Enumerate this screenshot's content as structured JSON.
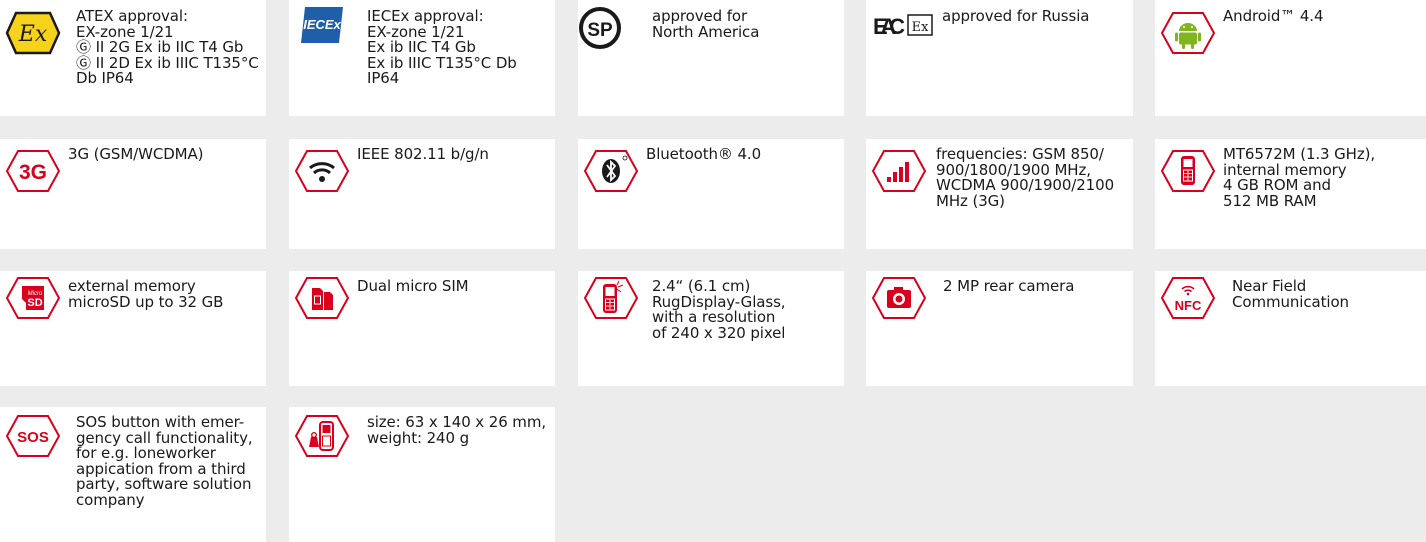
{
  "features": [
    {
      "id": "atex",
      "icon": "atex-ex-icon",
      "text": "ATEX approval:\nEX-zone 1/21\nⒼ II 2G Ex ib IIC T4 Gb\nⒼ II 2D Ex ib IIIC T135°C\nDb IP64"
    },
    {
      "id": "iecex",
      "icon": "iecex-logo",
      "text": "IECEx approval:\nEX-zone 1/21\nEx ib IIC T4 Gb\nEx ib IIIC T135°C Db\nIP64"
    },
    {
      "id": "csa",
      "icon": "csa-logo",
      "text": "approved for\nNorth America"
    },
    {
      "id": "eac",
      "icon": "eac-ex-logo",
      "text": "approved for Russia"
    },
    {
      "id": "android",
      "icon": "android-icon",
      "text": "Android™ 4.4"
    },
    {
      "id": "3g",
      "icon": "3g-icon",
      "text": "3G (GSM/WCDMA)"
    },
    {
      "id": "wifi",
      "icon": "wifi-icon",
      "text": "IEEE 802.11 b/g/n"
    },
    {
      "id": "bluetooth",
      "icon": "bluetooth-icon",
      "text": "Bluetooth® 4.0"
    },
    {
      "id": "frequencies",
      "icon": "signal-bars-icon",
      "text": "frequencies: GSM 850/\n900/1800/1900 MHz,\nWCDMA 900/1900/2100\nMHz (3G)"
    },
    {
      "id": "cpu",
      "icon": "phone-cpu-icon",
      "text": "MT6572M (1.3 GHz),\ninternal memory\n4 GB ROM and\n512 MB RAM"
    },
    {
      "id": "microsd",
      "icon": "microsd-icon",
      "text": "external memory\nmicroSD up to 32 GB"
    },
    {
      "id": "sim",
      "icon": "dual-sim-icon",
      "text": "Dual micro SIM"
    },
    {
      "id": "display",
      "icon": "display-icon",
      "text": "2.4“ (6.1 cm)\nRugDisplay-Glass,\nwith a resolution\nof 240 x 320 pixel"
    },
    {
      "id": "camera",
      "icon": "camera-icon",
      "text": "2 MP rear camera"
    },
    {
      "id": "nfc",
      "icon": "nfc-icon",
      "text": "Near Field\nCommunication"
    },
    {
      "id": "sos",
      "icon": "sos-icon",
      "text": "SOS button with emer-\ngency call functionality,\nfor e.g. loneworker\nappication from a third\nparty, software solution\ncompany"
    },
    {
      "id": "size",
      "icon": "size-weight-icon",
      "text": "size: 63 x 140 x 26 mm,\nweight: 240 g"
    }
  ],
  "icon_labels": {
    "ex": "Ex",
    "iecex": "IECEx",
    "csa": "SP",
    "eac": "EAC",
    "eac_ex": "Ex",
    "g3": "3G",
    "micro": "Micro",
    "sd": "SD",
    "nfc": "NFC",
    "sos": "SOS"
  },
  "colors": {
    "accent": "#d8001c",
    "android_green": "#7fb51f",
    "iecex_blue": "#1f5fa8",
    "cell_bg": "#ffffff",
    "page_bg": "#ececec"
  }
}
